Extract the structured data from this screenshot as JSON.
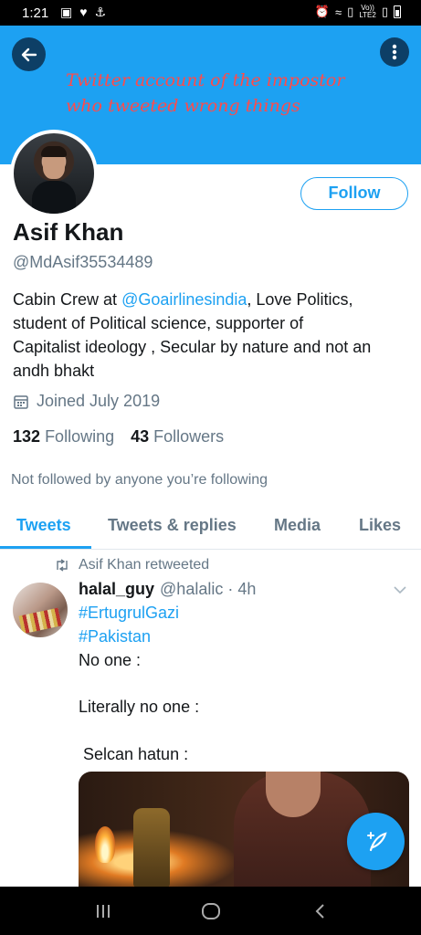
{
  "status_bar": {
    "time": "1:21",
    "network_label": "Vo))\nLTE2"
  },
  "banner": {
    "annotation_line1": "Twitter account of the impostor",
    "annotation_line2": "who tweeted wrong things",
    "annotation_color": "#ff4b4b",
    "background_color": "#1da1f2"
  },
  "profile": {
    "follow_label": "Follow",
    "name": "Asif Khan",
    "handle": "@MdAsif35534489",
    "bio_prefix": "Cabin Crew at ",
    "bio_mention": "@Goairlinesindia",
    "bio_line1_suffix": ",  Love Politics,",
    "bio_line2": "student of Political science, supporter of",
    "bio_line3": "Capitalist ideology , Secular by nature and not an",
    "bio_line4": "andh bhakt",
    "joined": "Joined July 2019",
    "following_count": "132",
    "following_label": "Following",
    "followers_count": "43",
    "followers_label": "Followers",
    "not_followed": "Not followed by anyone you’re following"
  },
  "tabs": [
    {
      "label": "Tweets",
      "active": true
    },
    {
      "label": "Tweets & replies",
      "active": false
    },
    {
      "label": "Media",
      "active": false
    },
    {
      "label": "Likes",
      "active": false
    }
  ],
  "tweet": {
    "retweeted_by": "Asif Khan retweeted",
    "username": "halal_guy",
    "handle_time": "@halalic · 4h",
    "hashtag1": "#ErtugrulGazi",
    "hashtag2": "#Pakistan",
    "line1": "No one :",
    "line2": "Literally no one :",
    "line3": " Selcan hatun :"
  },
  "icons": {
    "back": "arrow-left-icon",
    "more": "vertical-dots-icon",
    "calendar": "calendar-icon",
    "retweet": "retweet-icon",
    "chevron": "chevron-down-icon",
    "compose": "compose-tweet-icon",
    "nav_recent": "recent-apps-icon",
    "nav_home": "home-icon",
    "nav_back": "nav-back-icon"
  },
  "colors": {
    "accent": "#1da1f2",
    "text_secondary": "#657786",
    "text_primary": "#14171a"
  }
}
